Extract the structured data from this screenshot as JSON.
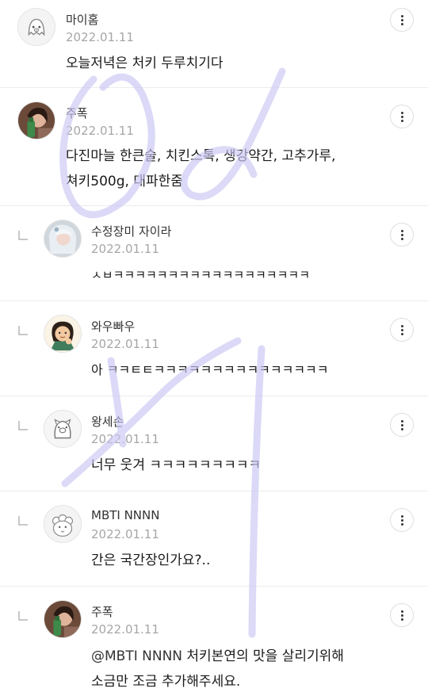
{
  "comments": [
    {
      "author": "마이홈",
      "date": "2022.01.11",
      "lines": [
        "오늘저녁은 처키 두루치기다"
      ],
      "avatar_icon": "ghost-mascot-avatar-icon",
      "reply": false
    },
    {
      "author": "주폭",
      "date": "2022.01.11",
      "lines": [
        "다진마늘 한큰술, 치킨스톡, 생강약간, 고추가루,",
        "쳐키500g, 대파한줌"
      ],
      "avatar_icon": "person-drinking-avatar-icon",
      "reply": false
    },
    {
      "author": "수정장미 자이라",
      "date": "2022.01.11",
      "lines": [
        "ㅅㅂㅋㅋㅋㅋㅋㅋㅋㅋㅋㅋㅋㅋㅋㅋㅋㅋㅋㅋ"
      ],
      "avatar_icon": "fantasy-character-avatar-icon",
      "reply": true
    },
    {
      "author": "와우빠우",
      "date": "2022.01.11",
      "lines": [
        "아 ㅋㅋㅌㅌㅋㅋㅋㅋㅋㅋㅋㅋㅋㅋㅋㅋㅋㅋㅋ"
      ],
      "avatar_icon": "cartoon-woman-avatar-icon",
      "reply": true
    },
    {
      "author": "왕세손",
      "date": "2022.01.11",
      "lines": [
        "너무 웃겨 ㅋㅋㅋㅋㅋㅋㅋㅋㅋ"
      ],
      "avatar_icon": "pig-mascot-avatar-icon",
      "reply": true
    },
    {
      "author": "MBTI NNNN",
      "date": "2022.01.11",
      "lines": [
        "간은 국간장인가요?.."
      ],
      "avatar_icon": "sheep-mascot-avatar-icon",
      "reply": true
    },
    {
      "author": "주폭",
      "date": "2022.01.11",
      "mention": "@MBTI NNNN",
      "lines": [
        " 처키본연의 맛을 살리기위해",
        "소금만 조금 추가해주세요."
      ],
      "avatar_icon": "person-drinking-avatar-icon",
      "reply": true
    }
  ],
  "colors": {
    "watermark": "#c9c6f3",
    "date": "#a6a6a6",
    "divider": "#ececec"
  },
  "icons": {
    "more": "more-vertical-icon",
    "reply": "reply-arrow-icon"
  }
}
